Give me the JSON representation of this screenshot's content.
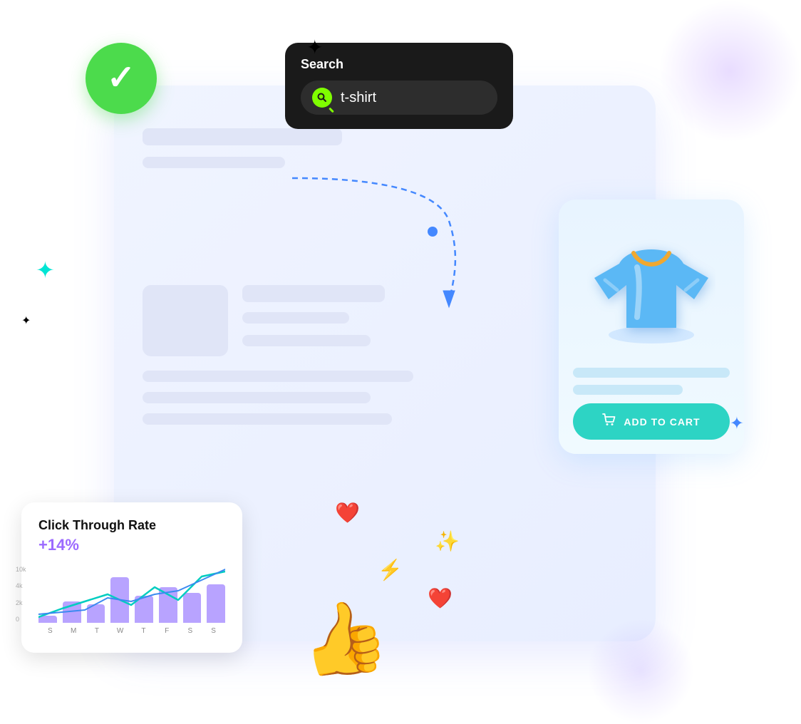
{
  "search": {
    "label": "Search",
    "query": "t-shirt",
    "placeholder": "t-shirt"
  },
  "product": {
    "add_to_cart_label": "ADD TO CART"
  },
  "ctr": {
    "title": "Click Through Rate",
    "value": "+14%",
    "y_labels": [
      "10k",
      "4k",
      "2k",
      "0"
    ],
    "x_labels": [
      "S",
      "M",
      "T",
      "W",
      "T",
      "F",
      "S",
      "S"
    ],
    "bars": [
      15,
      35,
      30,
      75,
      45,
      60,
      50,
      65
    ]
  },
  "sparkles": [
    {
      "id": "spark1",
      "color": "#00e5d4"
    },
    {
      "id": "spark2",
      "color": "#000"
    },
    {
      "id": "spark3",
      "color": "#4488ff"
    }
  ],
  "icons": {
    "checkmark": "✓",
    "cart": "🛒",
    "thumbs_up": "👍"
  }
}
